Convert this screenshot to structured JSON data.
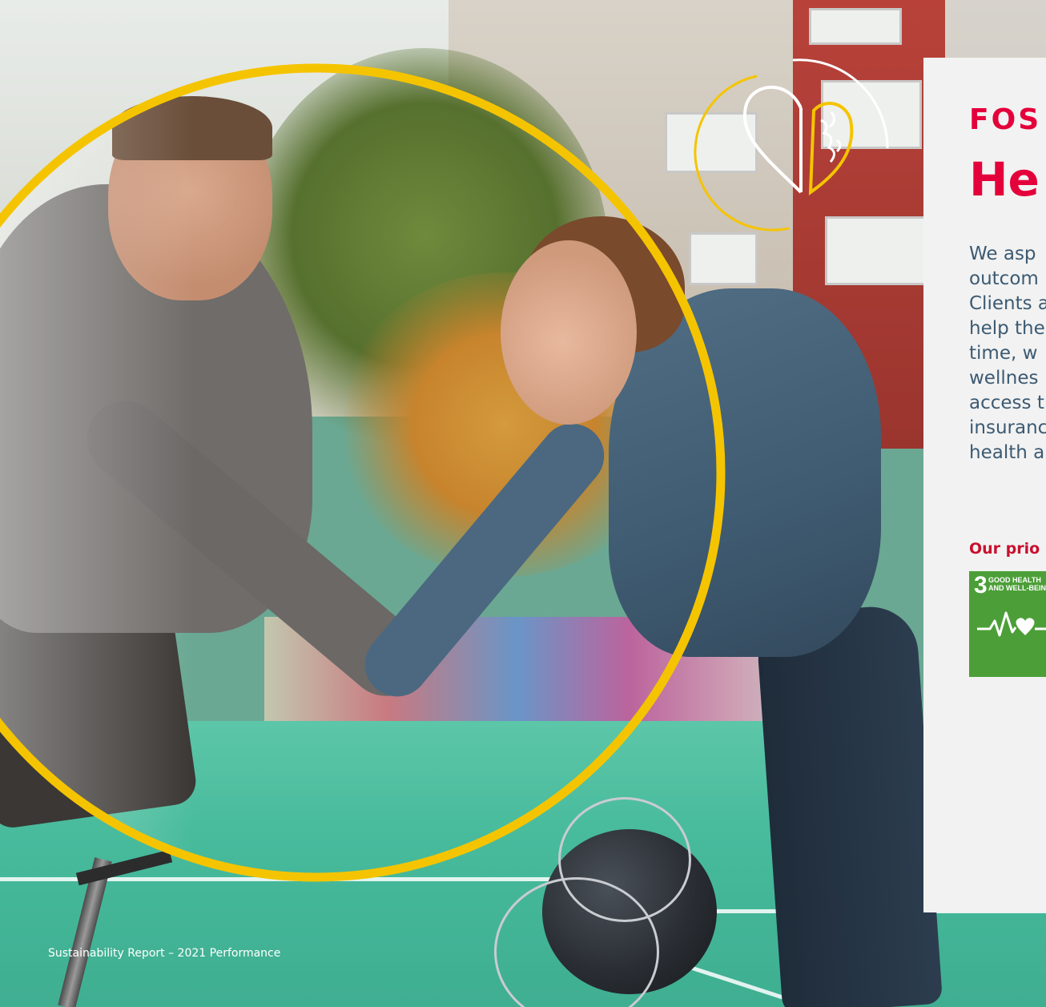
{
  "panel": {
    "eyebrow": "FOS",
    "title": "He",
    "body_lines": [
      "We asp",
      "outcom",
      "Clients a",
      "help the",
      "time, w",
      "wellnes",
      "access t",
      "insuranc",
      "health a"
    ],
    "priority_label": "Our prio",
    "sdg": {
      "number": "3",
      "title_line1": "GOOD HEALTH",
      "title_line2": "AND WELL-BEIN",
      "color": "#4c9f38",
      "icon": "heartbeat-icon"
    }
  },
  "footer": {
    "text": "Sustainability Report – 2021 Performance"
  },
  "colors": {
    "accent_red": "#e4003a",
    "circle_yellow": "#f5c400",
    "body_text": "#3c5a72",
    "panel_bg": "#f2f2f2"
  },
  "icons": {
    "heart_brain": "heart-brain-icon"
  }
}
